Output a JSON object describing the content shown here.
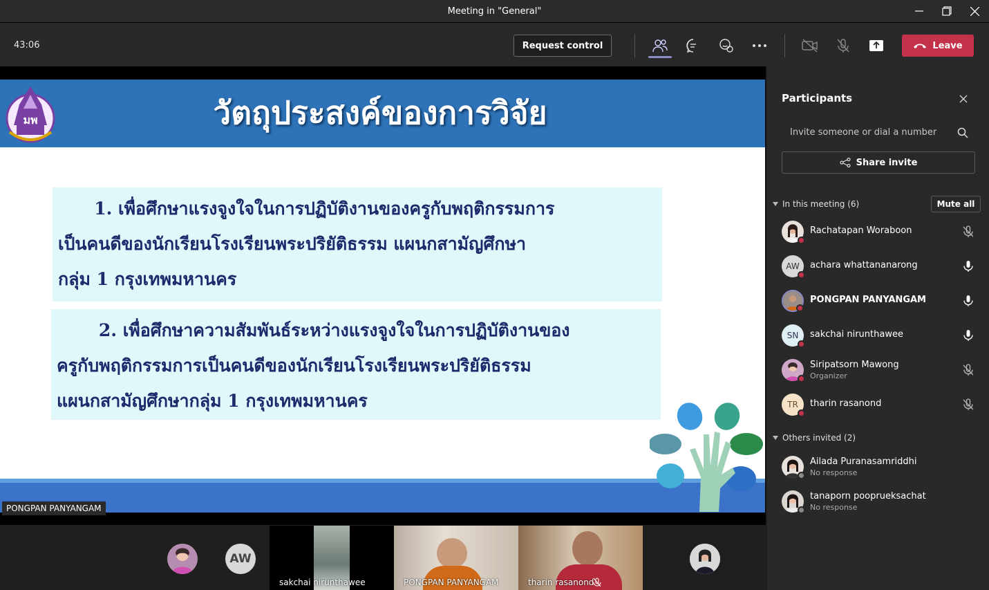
{
  "window": {
    "title": "Meeting in \"General\""
  },
  "toolbar": {
    "timer": "43:06",
    "request_control": "Request control",
    "leave_label": "Leave"
  },
  "slide": {
    "title": "วัตถุประสงค์ของการวิจัย",
    "objective1_lines": [
      "      1. เพื่อศึกษาแรงจูงใจในการปฏิบัติงานของครูกับพฤติกรรมการ",
      "เป็นคนดีของนักเรียนโรงเรียนพระปริยัติธรรม แผนกสามัญศึกษา",
      "กลุ่ม 1 กรุงเทพมหานคร"
    ],
    "objective2_lines": [
      "       2. เพื่อศึกษาความสัมพันธ์ระหว่างแรงจูงใจในการปฏิบัติงานของ",
      "ครูกับพฤติกรรมการเป็นคนดีของนักเรียนโรงเรียนพระปริยัติธรรม",
      "แผนกสามัญศึกษากลุ่ม 1 กรุงเทพมหานคร"
    ],
    "presenter_tag": "PONGPAN PANYANGAM"
  },
  "strip": {
    "aw_initials": "AW",
    "tiles": [
      {
        "label": "sakchai nirunthawee"
      },
      {
        "label": "PONGPAN PANYANGAM"
      },
      {
        "label": "tharin rasanond"
      }
    ]
  },
  "panel": {
    "title": "Participants",
    "invite_placeholder": "Invite someone or dial a number",
    "share_invite": "Share invite",
    "in_meeting_label": "In this meeting (6)",
    "mute_all": "Mute all",
    "participants": [
      {
        "name": "Rachatapan Woraboon",
        "initials": "",
        "sub": "",
        "mic": "muted"
      },
      {
        "name": "achara whattananarong",
        "initials": "AW",
        "sub": "",
        "mic": "on"
      },
      {
        "name": "PONGPAN PANYANGAM",
        "initials": "",
        "sub": "",
        "mic": "on"
      },
      {
        "name": "sakchai nirunthawee",
        "initials": "SN",
        "sub": "",
        "mic": "on"
      },
      {
        "name": "Siripatsorn Mawong",
        "initials": "",
        "sub": "Organizer",
        "mic": "muted"
      },
      {
        "name": "tharin rasanond",
        "initials": "TR",
        "sub": "",
        "mic": "muted"
      }
    ],
    "others_label": "Others invited (2)",
    "invited": [
      {
        "name": "Ailada Puranasamriddhi",
        "sub": "No response"
      },
      {
        "name": "tanaporn pooprueksachat",
        "sub": "No response"
      }
    ]
  },
  "colors": {
    "leave": "#c4314b",
    "slide_header": "#2e73b7",
    "box_bg": "#e1f8fa",
    "box_text": "#1b2a6b",
    "accent": "#8b8cc7"
  }
}
